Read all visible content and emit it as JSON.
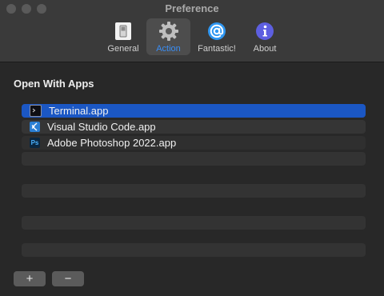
{
  "window": {
    "title": "Preference"
  },
  "toolbar": {
    "items": [
      {
        "label": "General",
        "icon": "switch-icon",
        "selected": false
      },
      {
        "label": "Action",
        "icon": "gear-icon",
        "selected": true
      },
      {
        "label": "Fantastic!",
        "icon": "at-sign-icon",
        "selected": false
      },
      {
        "label": "About",
        "icon": "info-icon",
        "selected": false
      }
    ]
  },
  "section": {
    "title": "Open With Apps"
  },
  "apps": [
    {
      "name": "Terminal.app",
      "icon": "terminal-icon",
      "selected": true
    },
    {
      "name": "Visual Studio Code.app",
      "icon": "vscode-icon",
      "selected": false
    },
    {
      "name": "Adobe Photoshop 2022.app",
      "icon": "photoshop-icon",
      "selected": false
    }
  ],
  "app_icon_texts": {
    "photoshop": "Ps"
  },
  "buttons": {
    "add": "+",
    "remove": "−"
  },
  "colors": {
    "accent": "#3a8ef6",
    "selection": "#1b57c4"
  }
}
